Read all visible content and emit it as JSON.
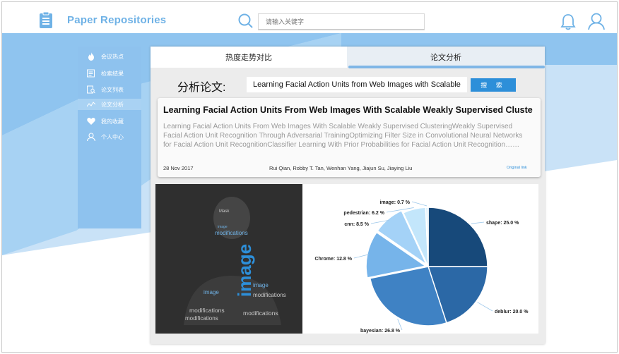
{
  "app": {
    "title": "Paper Repositories"
  },
  "search": {
    "placeholder": "请输入关键字"
  },
  "sidebar": {
    "items": [
      {
        "label": "会议热点",
        "icon": "fire-icon"
      },
      {
        "label": "检索结果",
        "icon": "list-icon"
      },
      {
        "label": "论文列表",
        "icon": "doc-search-icon"
      },
      {
        "label": "论文分析",
        "icon": "chart-line-icon"
      },
      {
        "label": "我的收藏",
        "icon": "heart-icon"
      },
      {
        "label": "个人中心",
        "icon": "person-icon"
      }
    ],
    "active_index": 3
  },
  "tabs": [
    {
      "label": "热度走势对比"
    },
    {
      "label": "论文分析"
    }
  ],
  "analysis": {
    "label": "分析论文:",
    "input_value": "Learning Facial Action Units from Web Images with Scalable",
    "button_label": "搜 索"
  },
  "paper": {
    "title": "Learning Facial Action Units From Web Images With Scalable Weakly Supervised Cluste",
    "abstract": "Learning Facial Action Units From Web Images With Scalable Weakly Supervised ClusteringWeakly Supervised Facial Action Unit Recognition Through Adversarial TrainingOptimizing Filter Size in Convolutional Neural Networks for Facial Action Unit RecognitionClassifier Learning With Prior Probabilities for Facial Action Unit Recognition……",
    "date": "28 Nov 2017",
    "authors": "Rui Qian, Robby T. Tan, Wenhan Yang, Jiajun Su, Jiaying Liu",
    "link_label": "Original link"
  },
  "wordcloud": {
    "words": [
      "image",
      "image",
      "modifications",
      "modifications",
      "modifications",
      "modifications",
      "image",
      "modifications",
      "image",
      "Mask"
    ]
  },
  "colors": {
    "accent": "#2d8fd9",
    "title": "#6fb2e6",
    "sidebar": "#8ec2ee",
    "band_light": "#c9e2f7",
    "band_dark": "#8fc4ef"
  },
  "chart_data": {
    "type": "pie",
    "slices": [
      {
        "label": "shape: 25.0 %",
        "value": 25.0,
        "color": "#17497a"
      },
      {
        "label": "deblur: 20.0 %",
        "value": 20.0,
        "color": "#2b68a6"
      },
      {
        "label": "bayesian: 26.8 %",
        "value": 26.8,
        "color": "#3f82c4"
      },
      {
        "label": "Chrome: 12.8 %",
        "value": 12.8,
        "color": "#76b4ea"
      },
      {
        "label": "cnn: 8.5 %",
        "value": 8.5,
        "color": "#a4d2f7"
      },
      {
        "label": "pedestrian: 6.2 %",
        "value": 6.2,
        "color": "#c3e6fb"
      },
      {
        "label": "image: 0.7 %",
        "value": 0.7,
        "color": "#dff2fd"
      }
    ]
  }
}
